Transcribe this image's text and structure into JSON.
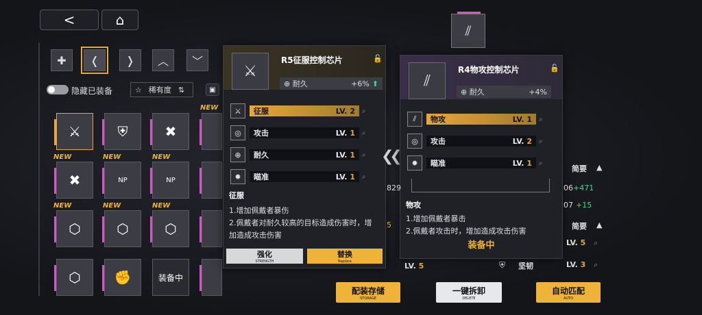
{
  "nav": {
    "back_icon": "back-arrow-icon",
    "home_icon": "home-icon"
  },
  "filters": [
    {
      "icon": "plus-cross-icon"
    },
    {
      "icon": "chevron-left-bracket-icon",
      "selected": true
    },
    {
      "icon": "chevron-right-bracket-icon"
    },
    {
      "icon": "chevron-up-icon"
    },
    {
      "icon": "chevron-down-icon"
    }
  ],
  "toolbar": {
    "hide_equipped": "隐藏已装备",
    "sort_label": "稀有度"
  },
  "grid": {
    "new_tag": "NEW",
    "equipped_label": "装备中",
    "np": "NP"
  },
  "panel_left": {
    "title": "R5征服控制芯片",
    "stat_name": "耐久",
    "stat_value": "+6%",
    "subs": [
      {
        "name": "征服",
        "lv_label": "LV.",
        "lv": "2",
        "highlight": true
      },
      {
        "name": "攻击",
        "lv_label": "LV.",
        "lv": "1"
      },
      {
        "name": "耐久",
        "lv_label": "LV.",
        "lv": "1"
      },
      {
        "name": "瞄准",
        "lv_label": "LV.",
        "lv": "1"
      }
    ],
    "effect_title": "征服",
    "effect_lines": [
      "1.增加佩戴者暴伤",
      "2.佩戴者对耐久较高的目标造成伤害时，增",
      "加造成攻击伤害"
    ],
    "btn_strengthen": "强化",
    "btn_strengthen_sub": "STRENGTH",
    "btn_replace": "替换",
    "btn_replace_sub": "Replace"
  },
  "panel_right": {
    "title": "R4物攻控制芯片",
    "stat_name": "耐久",
    "stat_value": "+4%",
    "subs": [
      {
        "name": "物攻",
        "lv_label": "LV.",
        "lv": "1",
        "highlight": true
      },
      {
        "name": "攻击",
        "lv_label": "LV.",
        "lv": "2"
      },
      {
        "name": "瞄准",
        "lv_label": "LV.",
        "lv": "1"
      }
    ],
    "effect_title": "物攻",
    "effect_lines": [
      "1.增加佩戴者暴击",
      "2.佩戴者攻击时，增加造成攻击伤害"
    ],
    "equipped": "装备中"
  },
  "right_side": {
    "brief1": "简要",
    "brief2": "简要",
    "n1": "829",
    "n2": "06",
    "d2": "+471",
    "n3": "07",
    "d3": "+15",
    "lv5_label": "LV.",
    "lv5": "5",
    "lv5b_label": "LV.",
    "lv5b": "5",
    "lv3_label": "LV.",
    "lv3": "3",
    "stat_name": "坚韧",
    "n5": "5"
  },
  "bottom": {
    "storage": "配装存储",
    "storage_sub": "STORAGE",
    "unequip": "一键拆卸",
    "unequip_sub": "DELETE",
    "auto": "自动匹配",
    "auto_sub": "AUTO"
  },
  "colors": {
    "gold": "#e7a73a",
    "purple": "#d455c9",
    "green": "#3ddc84"
  }
}
